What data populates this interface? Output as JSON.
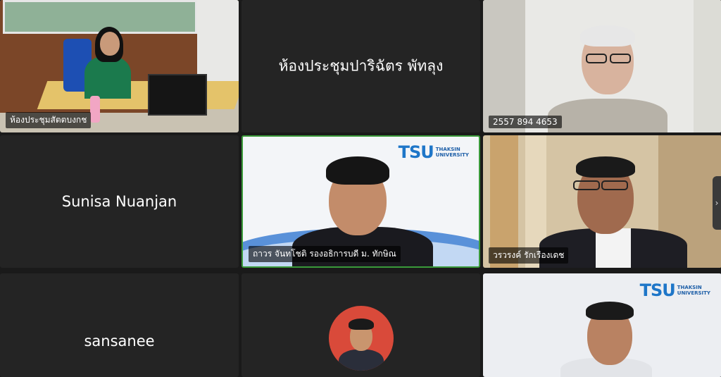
{
  "tiles": [
    {
      "id": "t1",
      "label": "ห้องประชุมสัตตบงกช",
      "type": "video"
    },
    {
      "id": "t2",
      "center_name": "ห้องประชุมปาริฉัตร พัทลุง",
      "type": "name"
    },
    {
      "id": "t3",
      "label": "2557 894 4653",
      "type": "video"
    },
    {
      "id": "t4",
      "center_name": "Sunisa Nuanjan",
      "type": "name"
    },
    {
      "id": "t5",
      "label": "ถาวร จันทโชติ รองอธิการบดี ม. ทักษิณ",
      "type": "video"
    },
    {
      "id": "t6",
      "label": "วรวรงค์ รักเรืองเดช",
      "type": "video"
    },
    {
      "id": "t7",
      "center_name": "sansanee",
      "type": "name"
    },
    {
      "id": "t8",
      "type": "avatar"
    },
    {
      "id": "t9",
      "type": "video"
    }
  ],
  "logo": {
    "letters": "TSU",
    "line1": "THAKSIN",
    "line2": "UNIVERSITY"
  },
  "icons": {
    "next_page": "chevron-right-icon"
  },
  "colors": {
    "background": "#1a1a1a",
    "tile": "#242424",
    "tsu_blue": "#1e76c8",
    "tsu_orange": "#f29111"
  }
}
